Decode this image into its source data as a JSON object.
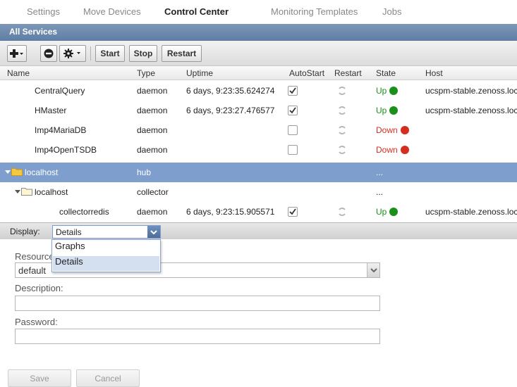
{
  "nav": {
    "tabs": [
      {
        "label": "Settings"
      },
      {
        "label": "Move Devices"
      },
      {
        "label": "Control Center",
        "active": true
      },
      {
        "label": "Monitoring Templates"
      },
      {
        "label": "Jobs"
      }
    ]
  },
  "panel": {
    "title": "All Services"
  },
  "toolbar": {
    "start_label": "Start",
    "stop_label": "Stop",
    "restart_label": "Restart"
  },
  "grid": {
    "headers": {
      "name": "Name",
      "type": "Type",
      "uptime": "Uptime",
      "autostart": "AutoStart",
      "restart": "Restart",
      "state": "State",
      "host": "Host"
    },
    "rows": [
      {
        "name": "CentralQuery",
        "type": "daemon",
        "uptime": "6 days, 9:23:35.624274",
        "autostart": true,
        "state": "Up",
        "host": "ucspm-stable.zenoss.loc"
      },
      {
        "name": "HMaster",
        "type": "daemon",
        "uptime": "6 days, 9:23:27.476577",
        "autostart": true,
        "state": "Up",
        "host": "ucspm-stable.zenoss.loc"
      },
      {
        "name": "Imp4MariaDB",
        "type": "daemon",
        "uptime": "",
        "autostart": false,
        "state": "Down",
        "host": ""
      },
      {
        "name": "Imp4OpenTSDB",
        "type": "daemon",
        "uptime": "",
        "autostart": false,
        "state": "Down",
        "host": ""
      },
      {
        "name": "localhost",
        "type": "hub",
        "uptime": "",
        "state": "...",
        "host": ""
      },
      {
        "name": "localhost",
        "type": "collector",
        "uptime": "",
        "state": "...",
        "host": ""
      },
      {
        "name": "collectorredis",
        "type": "daemon",
        "uptime": "6 days, 9:23:15.905571",
        "autostart": true,
        "state": "Up",
        "host": "ucspm-stable.zenoss.loc"
      }
    ]
  },
  "display": {
    "label": "Display:",
    "value": "Details",
    "options": [
      "Graphs",
      "Details"
    ]
  },
  "form": {
    "resource_pool_label": "Resource Pool:",
    "resource_pool_value": "default",
    "description_label": "Description:",
    "password_label": "Password:",
    "save_label": "Save",
    "cancel_label": "Cancel"
  },
  "colors": {
    "selected_row": "#7e9fcd",
    "up": "#1a8f1a",
    "down": "#d42e1f",
    "title_bar": "#6a87ad"
  }
}
